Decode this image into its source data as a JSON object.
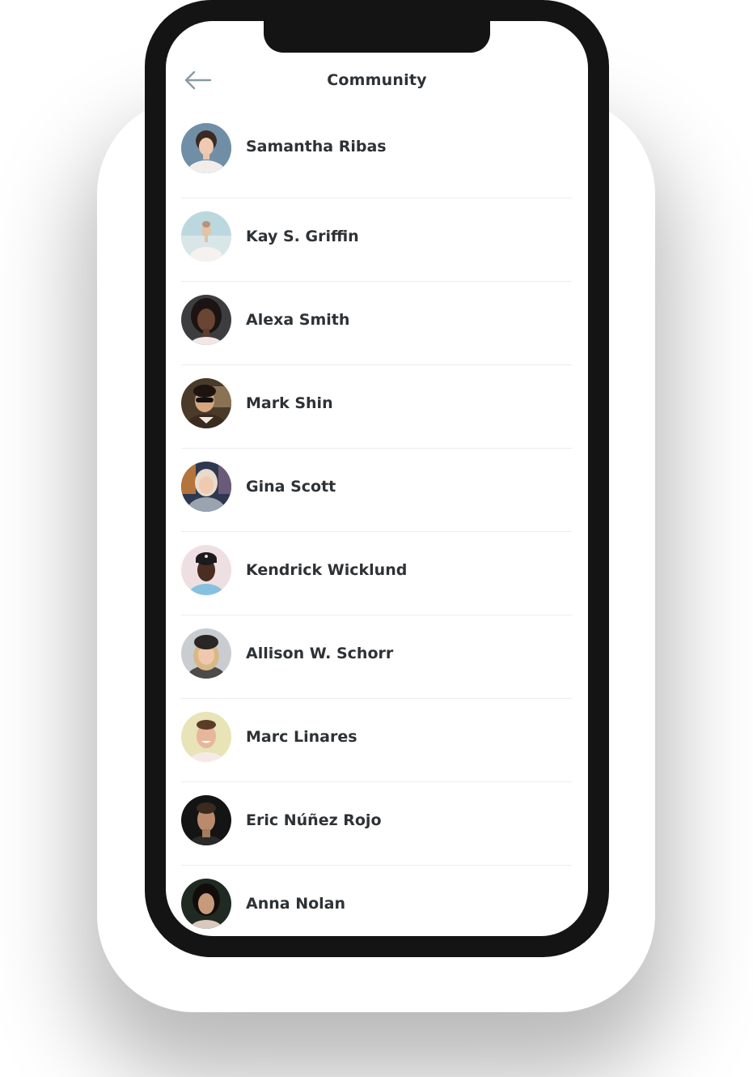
{
  "header": {
    "title": "Community",
    "back_icon": "arrow-left-icon"
  },
  "colors": {
    "text": "#2d3236",
    "back_arrow": "#8a9aa3",
    "divider": "#ececec",
    "device_frame": "#141414"
  },
  "members": [
    {
      "name": "Samantha Ribas",
      "avatar": "person-photo"
    },
    {
      "name": "Kay S. Griffin",
      "avatar": "person-photo"
    },
    {
      "name": "Alexa Smith",
      "avatar": "person-photo"
    },
    {
      "name": "Mark Shin",
      "avatar": "person-photo"
    },
    {
      "name": "Gina Scott",
      "avatar": "person-photo"
    },
    {
      "name": "Kendrick Wicklund",
      "avatar": "person-photo"
    },
    {
      "name": "Allison W. Schorr",
      "avatar": "person-photo"
    },
    {
      "name": "Marc Linares",
      "avatar": "person-photo"
    },
    {
      "name": "Eric Núñez Rojo",
      "avatar": "person-photo"
    },
    {
      "name": "Anna Nolan",
      "avatar": "person-photo"
    }
  ]
}
